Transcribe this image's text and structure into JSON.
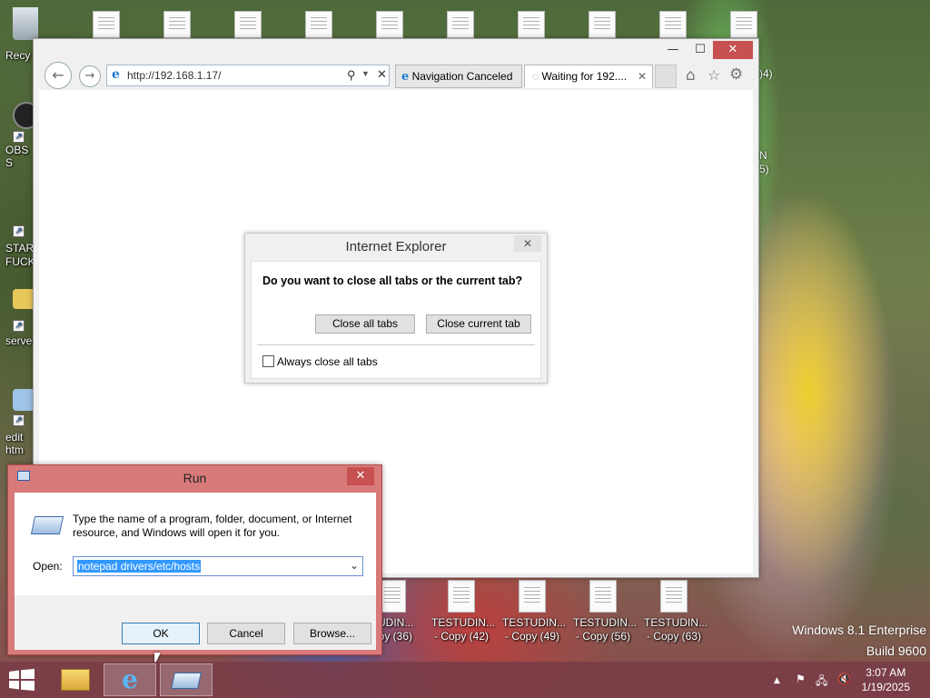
{
  "desktop": {
    "left_icons": [
      {
        "label": "Recy",
        "icon": "recycle-bin-icon"
      },
      {
        "label": "OBS S",
        "icon": "obs-icon"
      },
      {
        "label": "STAR FUCK",
        "icon": "shortcut-icon"
      },
      {
        "label": "serve",
        "icon": "folder-icon"
      },
      {
        "label": "edit htm",
        "icon": "file-icon"
      }
    ],
    "right_partial": [
      ")4)",
      "N",
      "5)"
    ],
    "bottom_icons": [
      {
        "line1": "TUDIN...",
        "line2": "opy (36)"
      },
      {
        "line1": "TESTUDIN...",
        "line2": "- Copy (42)"
      },
      {
        "line1": "TESTUDIN...",
        "line2": "- Copy (49)"
      },
      {
        "line1": "TESTUDIN...",
        "line2": "- Copy (56)"
      },
      {
        "line1": "TESTUDIN...",
        "line2": "- Copy (63)"
      }
    ],
    "watermark": {
      "line1": "Windows 8.1 Enterprise",
      "line2": "Build 9600"
    }
  },
  "ie": {
    "address": "http://192.168.1.17/",
    "tabs": [
      {
        "label": "Navigation Canceled",
        "active": false
      },
      {
        "label": "Waiting for 192....",
        "active": true
      }
    ],
    "buttons": {
      "minimize": "—",
      "maximize": "☐",
      "close": "✕"
    }
  },
  "ie_dialog": {
    "title": "Internet Explorer",
    "question": "Do you want to close all tabs or the current tab?",
    "close_all": "Close all tabs",
    "close_current": "Close current tab",
    "checkbox_label": "Always close all tabs",
    "checkbox_checked": false
  },
  "run_dialog": {
    "title": "Run",
    "description": "Type the name of a program, folder, document, or Internet resource, and Windows will open it for you.",
    "open_label": "Open:",
    "input_value": "notepad drivers/etc/hosts",
    "ok": "OK",
    "cancel": "Cancel",
    "browse": "Browse..."
  },
  "taskbar": {
    "time": "3:07 AM",
    "date": "1/19/2025",
    "apps": [
      "file-explorer-icon",
      "internet-explorer-icon",
      "run-icon"
    ]
  }
}
